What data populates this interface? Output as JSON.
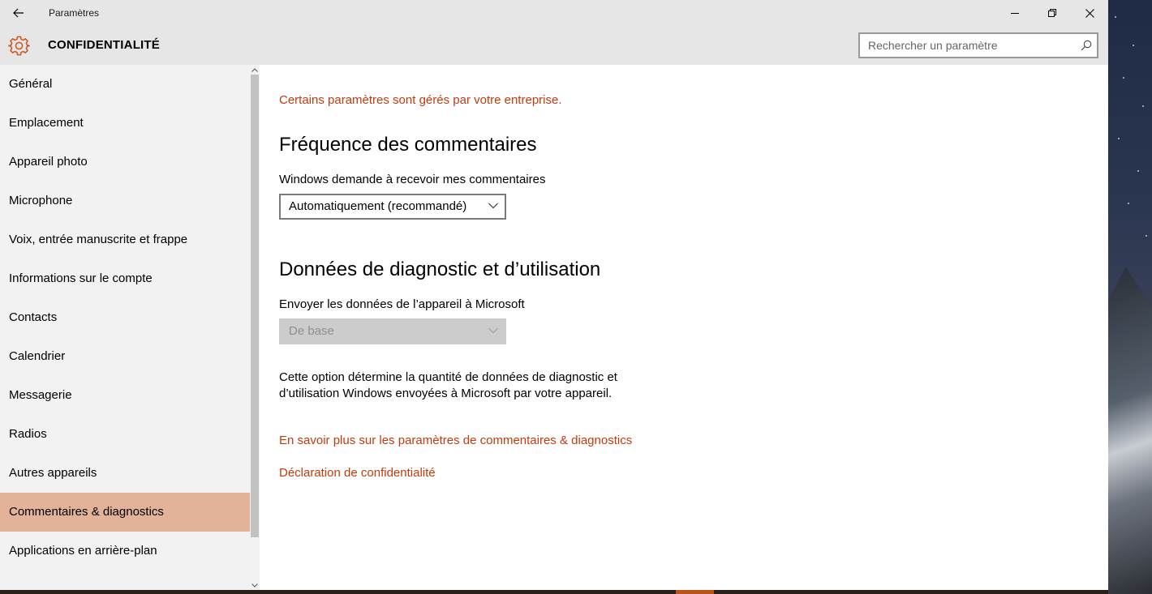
{
  "window": {
    "title": "Paramètres",
    "section_title": "CONFIDENTIALITÉ"
  },
  "search": {
    "placeholder": "Rechercher un paramètre"
  },
  "sidebar": {
    "items": [
      {
        "label": "Général",
        "selected": false
      },
      {
        "label": "Emplacement",
        "selected": false
      },
      {
        "label": "Appareil photo",
        "selected": false
      },
      {
        "label": "Microphone",
        "selected": false
      },
      {
        "label": "Voix, entrée manuscrite et frappe",
        "selected": false
      },
      {
        "label": "Informations sur le compte",
        "selected": false
      },
      {
        "label": "Contacts",
        "selected": false
      },
      {
        "label": "Calendrier",
        "selected": false
      },
      {
        "label": "Messagerie",
        "selected": false
      },
      {
        "label": "Radios",
        "selected": false
      },
      {
        "label": "Autres appareils",
        "selected": false
      },
      {
        "label": "Commentaires & diagnostics",
        "selected": true
      },
      {
        "label": "Applications en arrière-plan",
        "selected": false
      }
    ]
  },
  "main": {
    "managed_notice": "Certains paramètres sont gérés par votre entreprise.",
    "feedback": {
      "heading": "Fréquence des commentaires",
      "label": "Windows demande à recevoir mes commentaires",
      "selected": "Automatiquement (recommandé)"
    },
    "diagnostics": {
      "heading": "Données de diagnostic et d’utilisation",
      "label": "Envoyer les données de l’appareil à Microsoft",
      "selected": "De base",
      "description_line1": "Cette option détermine la quantité de données de diagnostic et",
      "description_line2": "d’utilisation Windows envoyées à Microsoft par votre appareil."
    },
    "links": {
      "learn_more": "En savoir plus sur les paramètres de commentaires & diagnostics",
      "privacy_statement": "Déclaration de confidentialité"
    }
  },
  "colors": {
    "accent": "#c23b0e",
    "selected_nav": "#e3b29a",
    "chrome": "#e6e6e6",
    "sidebar_bg": "#f2f2f2"
  }
}
